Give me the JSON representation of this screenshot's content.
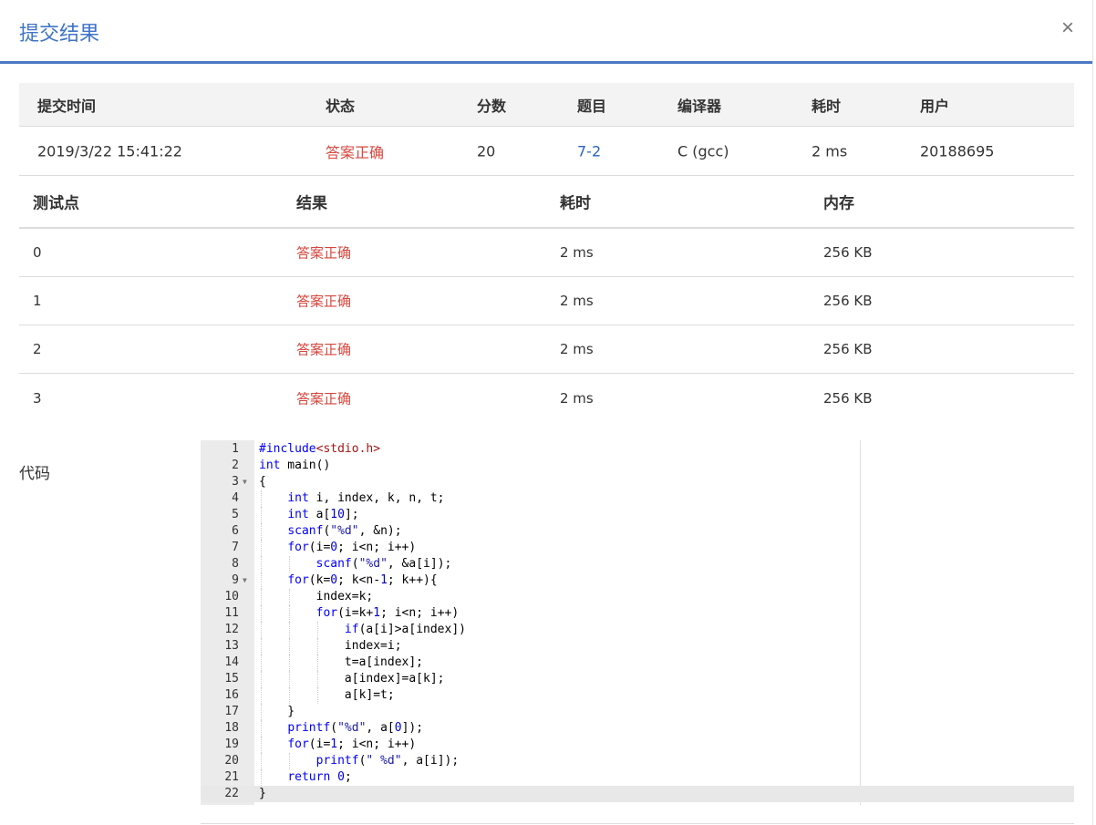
{
  "modal": {
    "title": "提交结果",
    "close": "×"
  },
  "summary": {
    "headers": [
      "提交时间",
      "状态",
      "分数",
      "题目",
      "编译器",
      "耗时",
      "用户"
    ],
    "row": {
      "time": "2019/3/22 15:41:22",
      "status": "答案正确",
      "score": "20",
      "problem": "7-2",
      "compiler": "C (gcc)",
      "duration": "2 ms",
      "user": "20188695"
    }
  },
  "tests": {
    "headers": [
      "测试点",
      "结果",
      "耗时",
      "内存"
    ],
    "rows": [
      {
        "id": "0",
        "result": "答案正确",
        "time": "2 ms",
        "memory": "256 KB"
      },
      {
        "id": "1",
        "result": "答案正确",
        "time": "2 ms",
        "memory": "256 KB"
      },
      {
        "id": "2",
        "result": "答案正确",
        "time": "2 ms",
        "memory": "256 KB"
      },
      {
        "id": "3",
        "result": "答案正确",
        "time": "2 ms",
        "memory": "256 KB"
      }
    ]
  },
  "code": {
    "label": "代码",
    "lines": [
      "#include<stdio.h>",
      "int main()",
      "{",
      "    int i, index, k, n, t;",
      "    int a[10];",
      "    scanf(\"%d\", &n);",
      "    for(i=0; i<n; i++)",
      "        scanf(\"%d\", &a[i]);",
      "    for(k=0; k<n-1; k++){",
      "        index=k;",
      "        for(i=k+1; i<n; i++)",
      "            if(a[i]>a[index])",
      "            index=i;",
      "            t=a[index];",
      "            a[index]=a[k];",
      "            a[k]=t;",
      "    }",
      "    printf(\"%d\", a[0]);",
      "    for(i=1; i<n; i++)",
      "        printf(\" %d\", a[i]);",
      "    return 0;",
      "}"
    ],
    "fold_lines": [
      3,
      9
    ],
    "active_line": 22
  }
}
